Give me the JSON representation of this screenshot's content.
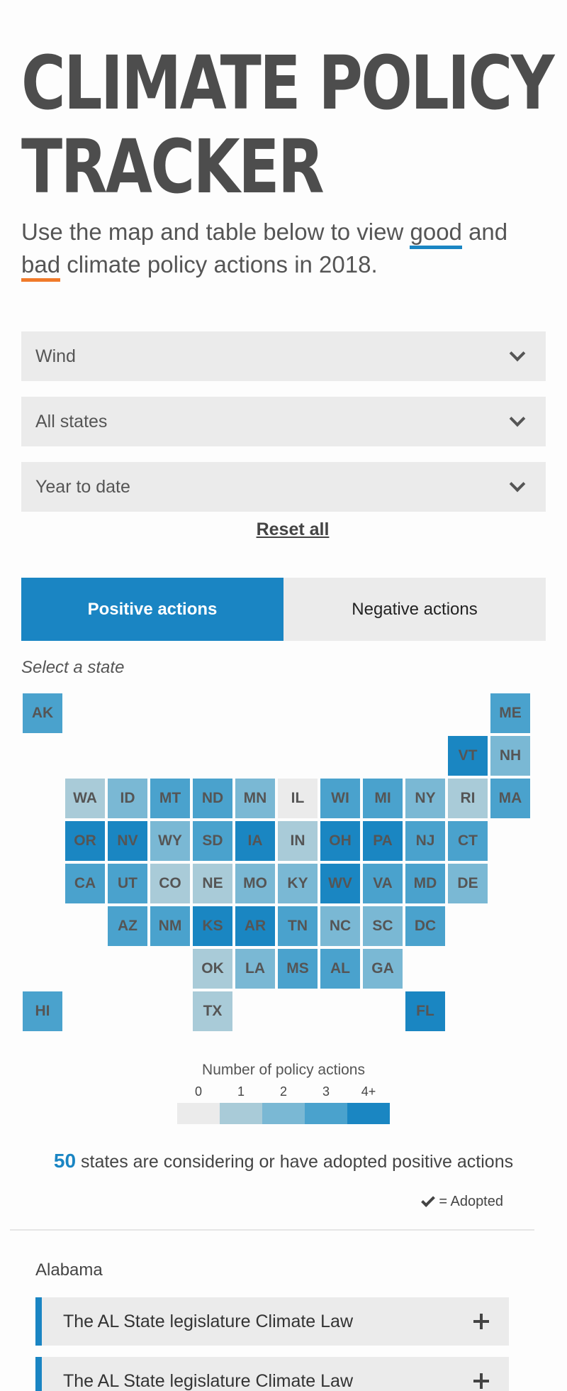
{
  "title_lines": [
    "Climate Policy",
    "Tracker"
  ],
  "intro": {
    "before": "Use the map and table below to view ",
    "good": "good",
    "middle": " and ",
    "bad": "bad",
    "after": " climate policy actions in 2018."
  },
  "filters": {
    "topic": "Wind",
    "state": "All states",
    "period": "Year to date",
    "reset": "Reset all"
  },
  "tabs": {
    "positive": "Positive actions",
    "negative": "Negative actions",
    "active": "positive"
  },
  "map": {
    "prompt": "Select a state",
    "colors": {
      "0": "#ebebeb",
      "1": "#a9cbd8",
      "2": "#7ab8d4",
      "3": "#4aa2cd",
      "4": "#1a86c2"
    },
    "states": [
      {
        "abbr": "AK",
        "level": 3
      },
      {
        "abbr": "ME",
        "level": 3
      },
      {
        "abbr": "VT",
        "level": 4
      },
      {
        "abbr": "NH",
        "level": 2
      },
      {
        "abbr": "WA",
        "level": 1
      },
      {
        "abbr": "ID",
        "level": 2
      },
      {
        "abbr": "MT",
        "level": 3
      },
      {
        "abbr": "ND",
        "level": 3
      },
      {
        "abbr": "MN",
        "level": 2
      },
      {
        "abbr": "IL",
        "level": 0
      },
      {
        "abbr": "WI",
        "level": 3
      },
      {
        "abbr": "MI",
        "level": 3
      },
      {
        "abbr": "NY",
        "level": 2
      },
      {
        "abbr": "RI",
        "level": 1
      },
      {
        "abbr": "MA",
        "level": 3
      },
      {
        "abbr": "OR",
        "level": 4
      },
      {
        "abbr": "NV",
        "level": 4
      },
      {
        "abbr": "WY",
        "level": 2
      },
      {
        "abbr": "SD",
        "level": 3
      },
      {
        "abbr": "IA",
        "level": 4
      },
      {
        "abbr": "IN",
        "level": 1
      },
      {
        "abbr": "OH",
        "level": 4
      },
      {
        "abbr": "PA",
        "level": 4
      },
      {
        "abbr": "NJ",
        "level": 3
      },
      {
        "abbr": "CT",
        "level": 3
      },
      {
        "abbr": "CA",
        "level": 3
      },
      {
        "abbr": "UT",
        "level": 3
      },
      {
        "abbr": "CO",
        "level": 1
      },
      {
        "abbr": "NE",
        "level": 1
      },
      {
        "abbr": "MO",
        "level": 2
      },
      {
        "abbr": "KY",
        "level": 2
      },
      {
        "abbr": "WV",
        "level": 4
      },
      {
        "abbr": "VA",
        "level": 3
      },
      {
        "abbr": "MD",
        "level": 3
      },
      {
        "abbr": "DE",
        "level": 2
      },
      {
        "abbr": "AZ",
        "level": 3
      },
      {
        "abbr": "NM",
        "level": 3
      },
      {
        "abbr": "KS",
        "level": 4
      },
      {
        "abbr": "AR",
        "level": 4
      },
      {
        "abbr": "TN",
        "level": 3
      },
      {
        "abbr": "NC",
        "level": 2
      },
      {
        "abbr": "SC",
        "level": 2
      },
      {
        "abbr": "DC",
        "level": 3
      },
      {
        "abbr": "OK",
        "level": 1
      },
      {
        "abbr": "LA",
        "level": 2
      },
      {
        "abbr": "MS",
        "level": 3
      },
      {
        "abbr": "AL",
        "level": 3
      },
      {
        "abbr": "GA",
        "level": 2
      },
      {
        "abbr": "HI",
        "level": 3
      },
      {
        "abbr": "TX",
        "level": 1
      },
      {
        "abbr": "FL",
        "level": 4
      }
    ]
  },
  "legend": {
    "title": "Number of policy actions",
    "ticks": [
      "0",
      "1",
      "2",
      "3",
      "4+"
    ]
  },
  "summary": {
    "count": "50",
    "text": "states are considering or have adopted positive actions",
    "adopted_label": "= Adopted"
  },
  "list": {
    "state": "Alabama",
    "items": [
      {
        "title": "The AL State legislature Climate Law"
      },
      {
        "title": "The AL State legislature Climate Law"
      }
    ]
  }
}
